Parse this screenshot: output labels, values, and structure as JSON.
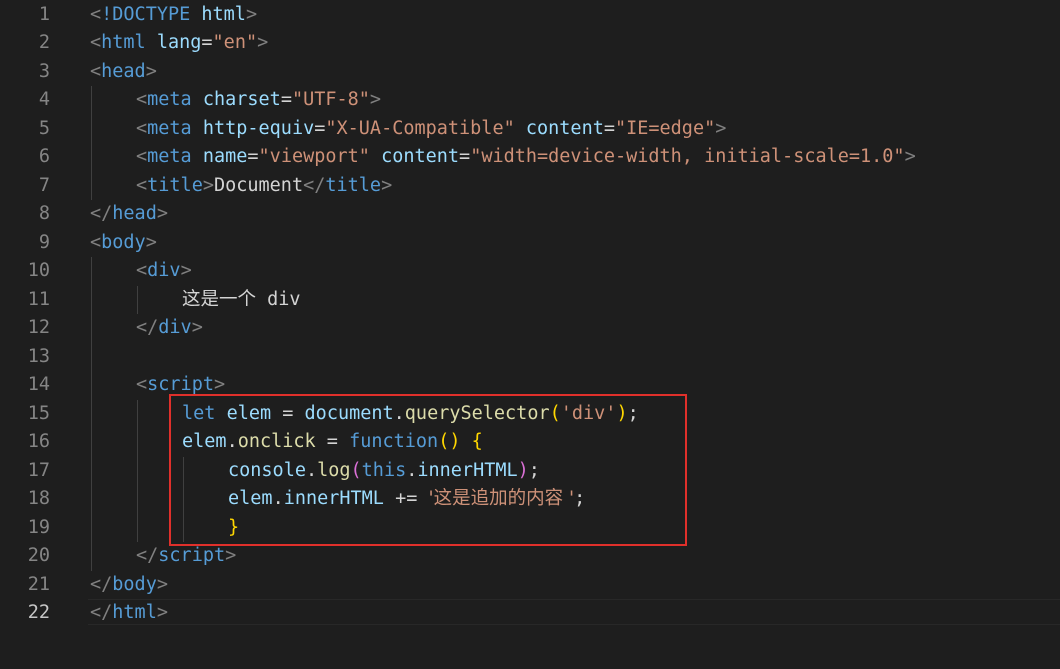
{
  "editor": {
    "current_line": "22",
    "line_numbers": [
      "1",
      "2",
      "3",
      "4",
      "5",
      "6",
      "7",
      "8",
      "9",
      "10",
      "11",
      "12",
      "13",
      "14",
      "15",
      "16",
      "17",
      "18",
      "19",
      "20",
      "21",
      "22"
    ],
    "lines": {
      "l1": {
        "p1": "<",
        "p2": "!DOCTYPE",
        "p3": " ",
        "p4": "html",
        "p5": ">"
      },
      "l2": {
        "p1": "<",
        "p2": "html",
        "p3": " ",
        "p4": "lang",
        "p5": "=",
        "p6": "\"en\"",
        "p7": ">"
      },
      "l3": {
        "p1": "<",
        "p2": "head",
        "p3": ">"
      },
      "l4": {
        "p1": "<",
        "p2": "meta",
        "p3": " ",
        "p4": "charset",
        "p5": "=",
        "p6": "\"UTF-8\"",
        "p7": ">"
      },
      "l5": {
        "p1": "<",
        "p2": "meta",
        "p3": " ",
        "p4": "http-equiv",
        "p5": "=",
        "p6": "\"X-UA-Compatible\"",
        "p7": " ",
        "p8": "content",
        "p9": "=",
        "p10": "\"IE=edge\"",
        "p11": ">"
      },
      "l6": {
        "p1": "<",
        "p2": "meta",
        "p3": " ",
        "p4": "name",
        "p5": "=",
        "p6": "\"viewport\"",
        "p7": " ",
        "p8": "content",
        "p9": "=",
        "p10": "\"width=device-width, initial-scale=1.0\"",
        "p11": ">"
      },
      "l7": {
        "p1": "<",
        "p2": "title",
        "p3": ">",
        "p4": "Document",
        "p5": "</",
        "p6": "title",
        "p7": ">"
      },
      "l8": {
        "p1": "</",
        "p2": "head",
        "p3": ">"
      },
      "l9": {
        "p1": "<",
        "p2": "body",
        "p3": ">"
      },
      "l10": {
        "p1": "<",
        "p2": "div",
        "p3": ">"
      },
      "l11": {
        "p1": "这是一个",
        "p2": " div"
      },
      "l12": {
        "p1": "</",
        "p2": "div",
        "p3": ">"
      },
      "l14": {
        "p1": "<",
        "p2": "script",
        "p3": ">"
      },
      "l15": {
        "p1": "let",
        "p2": " ",
        "p3": "elem",
        "p4": " = ",
        "p5": "document",
        "p6": ".",
        "p7": "querySelector",
        "p8": "(",
        "p9": "'div'",
        "p10": ")",
        "p11": ";"
      },
      "l16": {
        "p1": "elem",
        "p2": ".",
        "p3": "onclick",
        "p4": " = ",
        "p5": "function",
        "p6": "()",
        "p7": " ",
        "p8": "{"
      },
      "l17": {
        "p1": "console",
        "p2": ".",
        "p3": "log",
        "p4": "(",
        "p5": "this",
        "p6": ".",
        "p7": "innerHTML",
        "p8": ")",
        "p9": ";"
      },
      "l18": {
        "p1": "elem",
        "p2": ".",
        "p3": "innerHTML",
        "p4": " += ",
        "p5": "'这是追加的内容 '",
        "p6": ";"
      },
      "l19": {
        "p1": "}"
      },
      "l20": {
        "p1": "</",
        "p2": "script",
        "p3": ">"
      },
      "l21": {
        "p1": "</",
        "p2": "body",
        "p3": ">"
      },
      "l22": {
        "p1": "</",
        "p2": "html",
        "p3": ">"
      }
    }
  }
}
